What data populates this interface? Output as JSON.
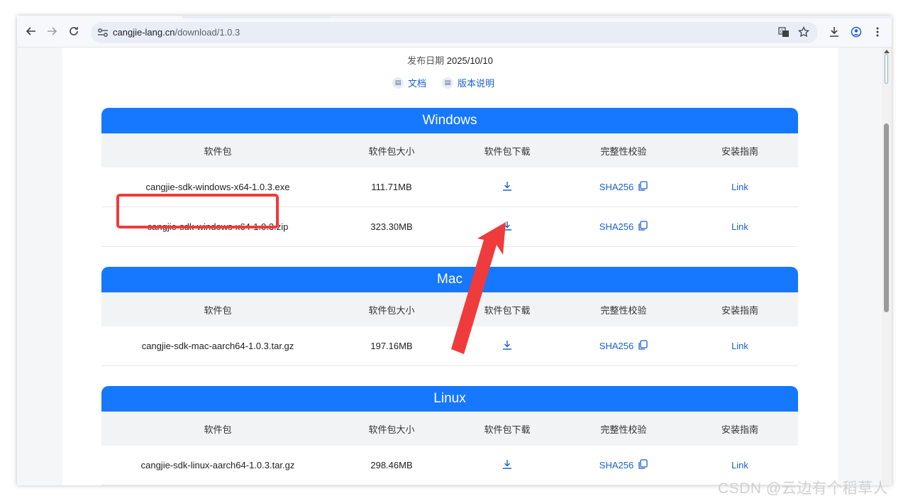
{
  "browser": {
    "url_domain": "cangjie-lang.cn",
    "url_path": "/download/1.0.3"
  },
  "page": {
    "release_label": "发布日期",
    "release_date": "2025/10/10",
    "docs_link": "文档",
    "release_notes_link": "版本说明"
  },
  "table_headers": {
    "package": "软件包",
    "size": "软件包大小",
    "download": "软件包下载",
    "checksum": "完整性校验",
    "guide": "安装指南"
  },
  "sections": [
    {
      "title": "Windows",
      "rows": [
        {
          "file": "cangjie-sdk-windows-x64-1.0.3.exe",
          "size": "111.71MB",
          "sha": "SHA256",
          "link": "Link"
        },
        {
          "file": "cangjie-sdk-windows-x64-1.0.3.zip",
          "size": "323.30MB",
          "sha": "SHA256",
          "link": "Link"
        }
      ]
    },
    {
      "title": "Mac",
      "rows": [
        {
          "file": "cangjie-sdk-mac-aarch64-1.0.3.tar.gz",
          "size": "197.16MB",
          "sha": "SHA256",
          "link": "Link"
        }
      ]
    },
    {
      "title": "Linux",
      "rows": [
        {
          "file": "cangjie-sdk-linux-aarch64-1.0.3.tar.gz",
          "size": "298.46MB",
          "sha": "SHA256",
          "link": "Link"
        }
      ]
    }
  ],
  "watermark": "CSDN @云边有个稻草人",
  "colors": {
    "accent": "#1677ff",
    "link": "#1a5fd0",
    "highlight": "#ef3b3b"
  }
}
